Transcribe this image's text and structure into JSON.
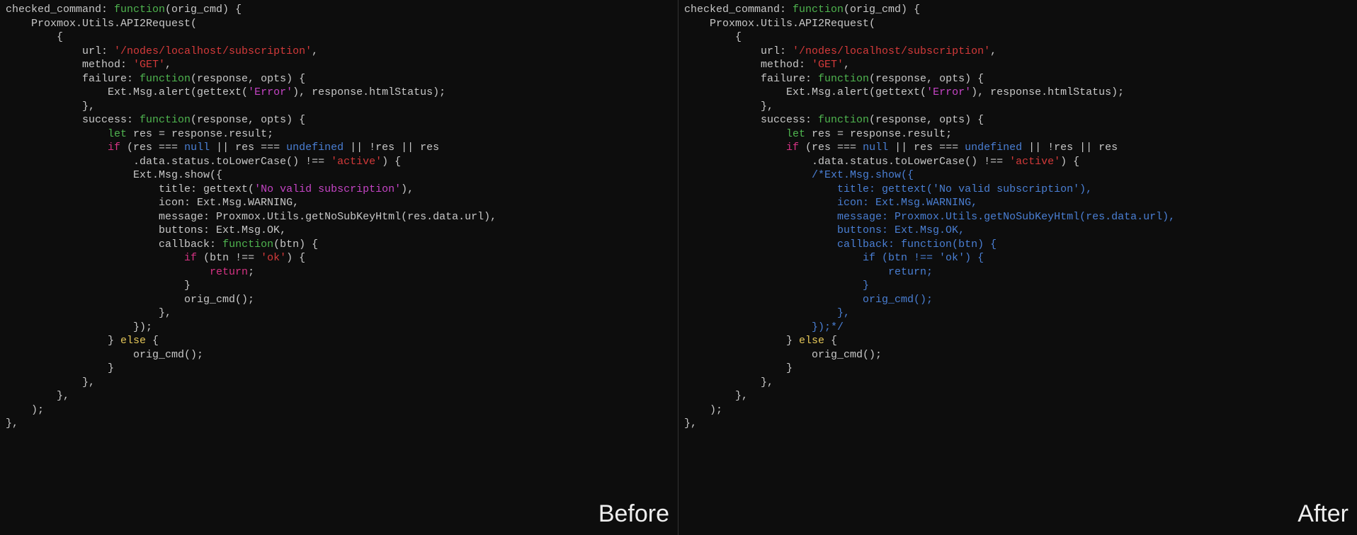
{
  "labels": {
    "before": "Before",
    "after": "After"
  },
  "tokens": {
    "function": "function",
    "let": "let",
    "if": "if",
    "else": "else",
    "return": "return",
    "null": "null",
    "undefined": "undefined"
  },
  "code": {
    "line01_a": "checked_command: ",
    "line01_b": "(orig_cmd) {",
    "line02": "    Proxmox.Utils.API2Request(",
    "line03": "        {",
    "line04_a": "            url: ",
    "line04_b": "'/nodes/localhost/subscription'",
    "line04_c": ",",
    "line05_a": "            method: ",
    "line05_b": "'GET'",
    "line05_c": ",",
    "line06_a": "            failure: ",
    "line06_b": "(response, opts) {",
    "line07_a": "                Ext.Msg.alert(gettext(",
    "line07_b": "'Error'",
    "line07_c": "), response.htmlStatus);",
    "line08": "            },",
    "line09_a": "            success: ",
    "line09_b": "(response, opts) {",
    "line10_a": "                ",
    "line10_b": " res = response.result;",
    "line11_a": "                ",
    "line11_b": " (res === ",
    "line11_c": " || res === ",
    "line11_d": " || !res || res",
    "line12_a": "                    .data.status.toLowerCase() !== ",
    "line12_b": "'active'",
    "line12_c": ") {",
    "line13_before": "                    Ext.Msg.show({",
    "line13_after": "                    /*Ext.Msg.show({",
    "line14a": "                        title: gettext(",
    "line14b": "'No valid subscription'",
    "line14c": "),",
    "line14_after": "                        title: gettext('No valid subscription'),",
    "line15": "                        icon: Ext.Msg.WARNING,",
    "line16": "                        message: Proxmox.Utils.getNoSubKeyHtml(res.data.url),",
    "line17": "                        buttons: Ext.Msg.OK,",
    "line18a": "                        callback: ",
    "line18b": "(btn) {",
    "line18_after": "                        callback: function(btn) {",
    "line19a": "                            ",
    "line19b": " (btn !== ",
    "line19c": "'ok'",
    "line19d": ") {",
    "line19_after": "                            if (btn !== 'ok') {",
    "line20a": "                                ",
    "line20b": ";",
    "line20_after": "                                return;",
    "line21": "                            }",
    "line22": "                            orig_cmd();",
    "line23": "                        },",
    "line24_before": "                    });",
    "line24_after": "                    });*/",
    "line25a": "                } ",
    "line25b": " {",
    "line26": "                    orig_cmd();",
    "line27": "                }",
    "line28": "            },",
    "line29": "        },",
    "line30": "    );",
    "line31": "},"
  }
}
